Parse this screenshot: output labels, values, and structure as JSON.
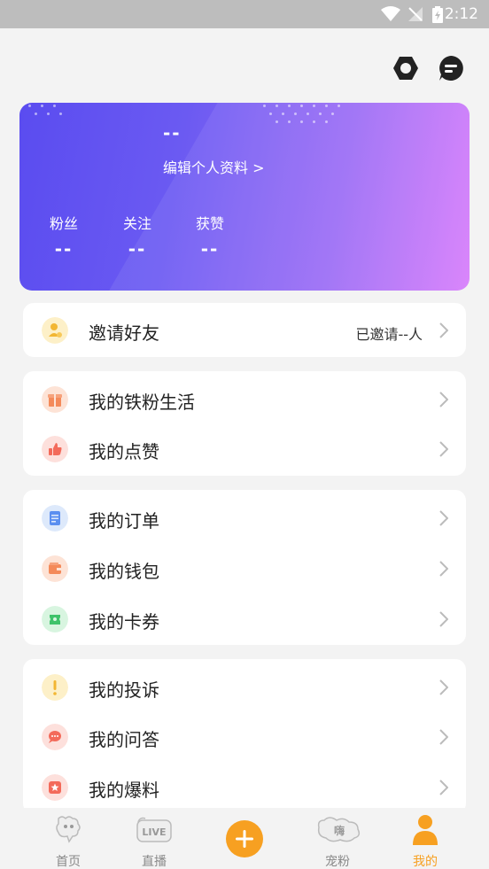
{
  "status_bar": {
    "time": "2:12"
  },
  "profile": {
    "username": "--",
    "edit_link": "编辑个人资料 >",
    "stats": [
      {
        "label": "粉丝",
        "value": "--"
      },
      {
        "label": "关注",
        "value": "--"
      },
      {
        "label": "获赞",
        "value": "--"
      }
    ]
  },
  "invite": {
    "label": "邀请好友",
    "status": "已邀请--人"
  },
  "groups": [
    {
      "items": [
        {
          "label": "我的铁粉生活",
          "icon": "gift-icon"
        },
        {
          "label": "我的点赞",
          "icon": "thumbs-up-icon"
        }
      ]
    },
    {
      "items": [
        {
          "label": "我的订单",
          "icon": "order-icon"
        },
        {
          "label": "我的钱包",
          "icon": "wallet-icon"
        },
        {
          "label": "我的卡券",
          "icon": "coupon-icon"
        }
      ]
    },
    {
      "items": [
        {
          "label": "我的投诉",
          "icon": "exclamation-icon"
        },
        {
          "label": "我的问答",
          "icon": "chat-icon"
        },
        {
          "label": "我的爆料",
          "icon": "star-badge-icon"
        }
      ]
    }
  ],
  "tabs": [
    {
      "label": "首页",
      "icon": "home-icon"
    },
    {
      "label": "直播",
      "icon": "live-icon"
    },
    {
      "label": "",
      "icon": "plus-icon"
    },
    {
      "label": "宠粉",
      "icon": "pet-fan-icon"
    },
    {
      "label": "我的",
      "icon": "user-icon",
      "active": true
    }
  ],
  "colors": {
    "accent": "#f7a021",
    "card_gradient_start": "#5a4cf0",
    "card_gradient_end": "#d77cfb"
  }
}
